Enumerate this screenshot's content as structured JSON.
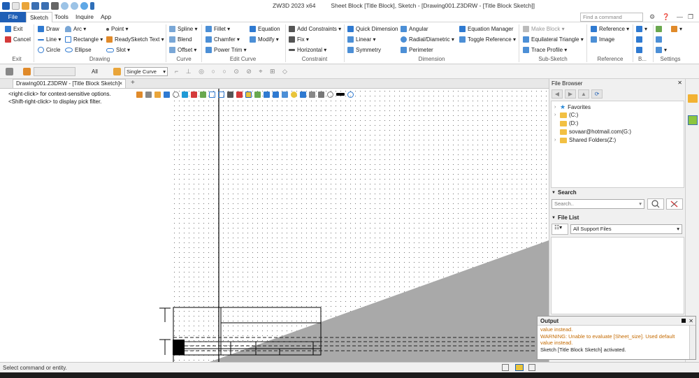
{
  "window": {
    "app_title": "ZW3D 2023 x64",
    "doc_title": "Sheet Block [Title Block],  Sketch - [Drawing001.Z3DRW - [Title Block Sketch]]"
  },
  "menu": {
    "tabs": [
      "File",
      "Sketch",
      "Tools",
      "Inquire",
      "App"
    ],
    "search_placeholder": "Find a command"
  },
  "ribbon": {
    "exit": {
      "exit_label": "Exit",
      "cancel_label": "Cancel",
      "group": "Exit"
    },
    "drawing": {
      "items": [
        "Draw",
        "Arc",
        "Point",
        "Line",
        "Rectangle",
        "ReadySketch Text",
        "Circle",
        "Ellipse",
        "Slot"
      ],
      "group": "Drawing"
    },
    "curve": {
      "items": [
        "Spline",
        "Blend",
        "Offset"
      ],
      "group": "Curve"
    },
    "edit_curve": {
      "items": [
        "Fillet",
        "Equation",
        "Chamfer",
        "Modify",
        "Power Trim"
      ],
      "group": "Edit Curve"
    },
    "constraint": {
      "items": [
        "Add Constraints",
        "Fix",
        "Horizontal"
      ],
      "group": "Constraint"
    },
    "dimension": {
      "items": [
        "Quick Dimension",
        "Angular",
        "Equation Manager",
        "Linear",
        "Radial/Diametric",
        "Toggle Reference",
        "Symmetry",
        "Perimeter"
      ],
      "group": "Dimension"
    },
    "sub_sketch": {
      "items": [
        "Make Block",
        "Equilateral Triangle",
        "Trace Profile"
      ],
      "group": "Sub-Sketch"
    },
    "reference": {
      "items": [
        "Reference",
        "Image"
      ],
      "group": "Reference"
    },
    "b_group": {
      "group": "B..."
    },
    "settings": {
      "group": "Settings"
    }
  },
  "toolbar": {
    "all_label": "All",
    "filter_value": "Single Curve"
  },
  "document": {
    "tab_label": "Drawing001.Z3DRW - [Title Block Sketch]",
    "close_glyph": "×",
    "add_glyph": "+"
  },
  "canvas": {
    "hint_right_click": "<right-click> for context-sensitive options.",
    "hint_shift_right_click": "<Shift-right-click> to display pick filter."
  },
  "file_browser": {
    "title": "File Browser",
    "tree": [
      {
        "label": "Favorites",
        "kind": "star"
      },
      {
        "label": "(C:)",
        "kind": "folder"
      },
      {
        "label": "(D:)",
        "kind": "folder"
      },
      {
        "label": "sovaar@hotmail.com(G:)",
        "kind": "folder"
      },
      {
        "label": "Shared Folders(Z:)",
        "kind": "folder"
      }
    ],
    "search": {
      "header": "Search",
      "placeholder": "Search.."
    },
    "file_list": {
      "header": "File List",
      "filter_value": "All Support Files"
    }
  },
  "output": {
    "title": "Output",
    "lines": [
      {
        "text": "value instead.",
        "type": "warn"
      },
      {
        "text": "WARNING: Unable to evaluate [Sheet_size]. Used default",
        "type": "warn"
      },
      {
        "text": "value instead.",
        "type": "warn"
      },
      {
        "text": "Sketch [Title Block Sketch] activated.",
        "type": "info"
      }
    ]
  },
  "status": {
    "text": "Select command or entity."
  },
  "colors": {
    "accent": "#1f5fb6",
    "warning_text": "#c46a00",
    "folder": "#f2c043"
  }
}
